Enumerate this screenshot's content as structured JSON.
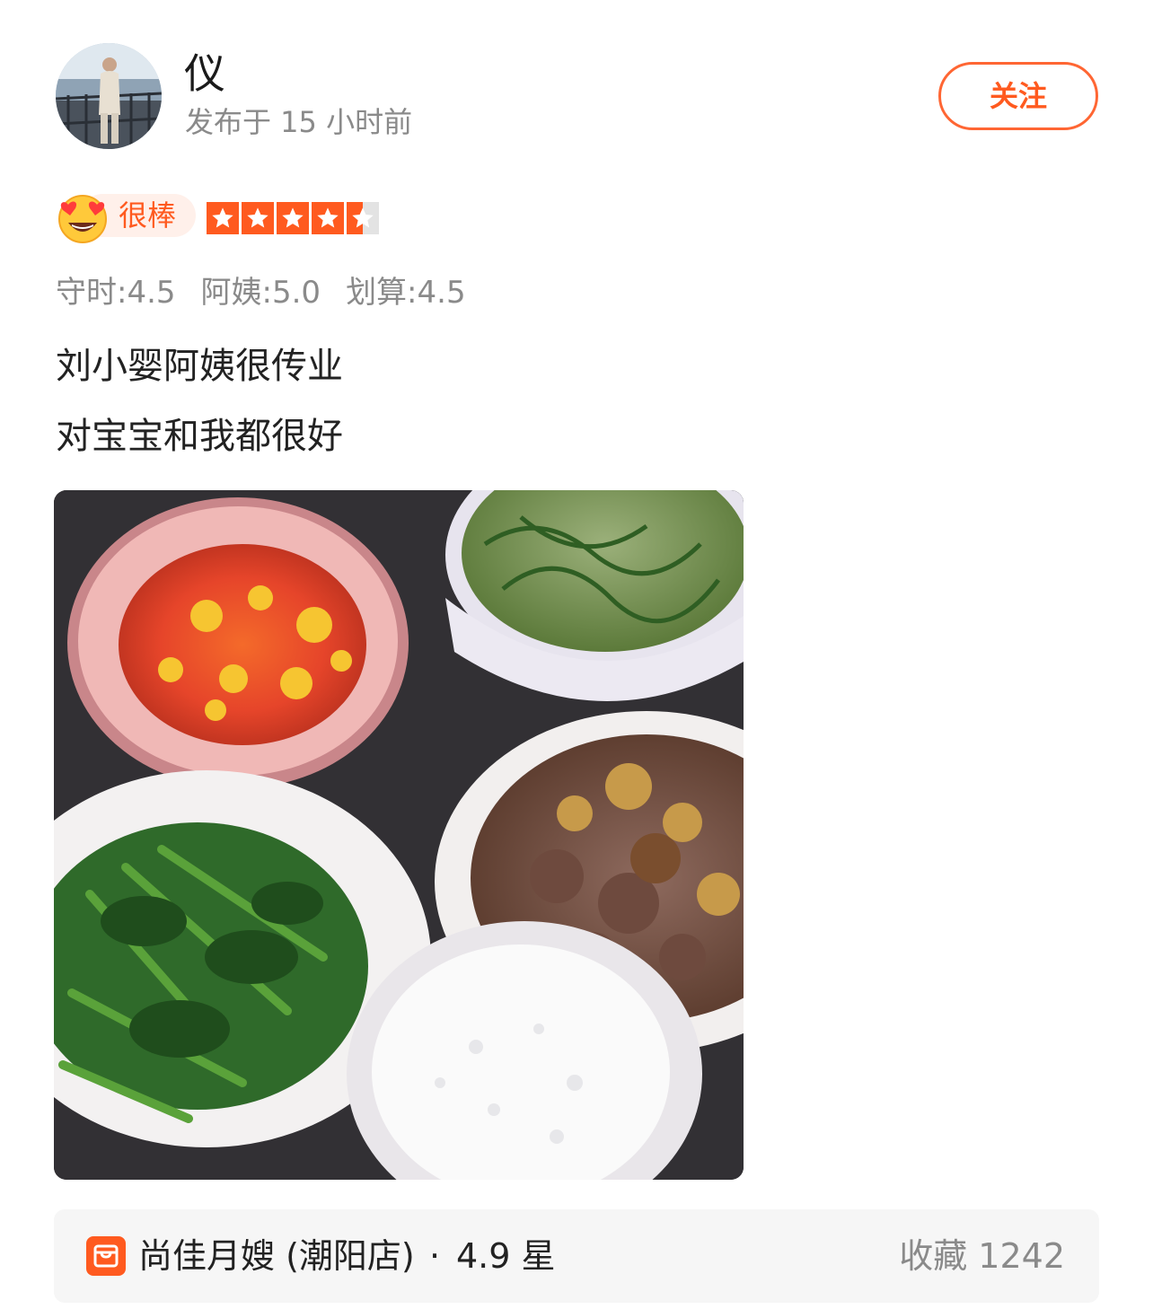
{
  "user": {
    "name": "仪",
    "post_time": "发布于 15 小时前"
  },
  "follow_label": "关注",
  "rating": {
    "label": "很棒",
    "stars": 4.5,
    "stars_max": 5
  },
  "sub_scores": [
    {
      "text": "守时:4.5"
    },
    {
      "text": "阿姨:5.0"
    },
    {
      "text": "划算:4.5"
    }
  ],
  "review": {
    "line1": "刘小婴阿姨很传业",
    "line2": "对宝宝和我都很好"
  },
  "shop": {
    "name": "尚佳月嫂 (潮阳店)",
    "separator": "·",
    "rating": "4.9 星",
    "favorites": "收藏 1242"
  },
  "colors": {
    "accent": "#ff5a1f",
    "muted": "#8a8a8a"
  },
  "icons": [
    "heart-eyes-emoji-icon",
    "star-icon",
    "shop-icon"
  ]
}
